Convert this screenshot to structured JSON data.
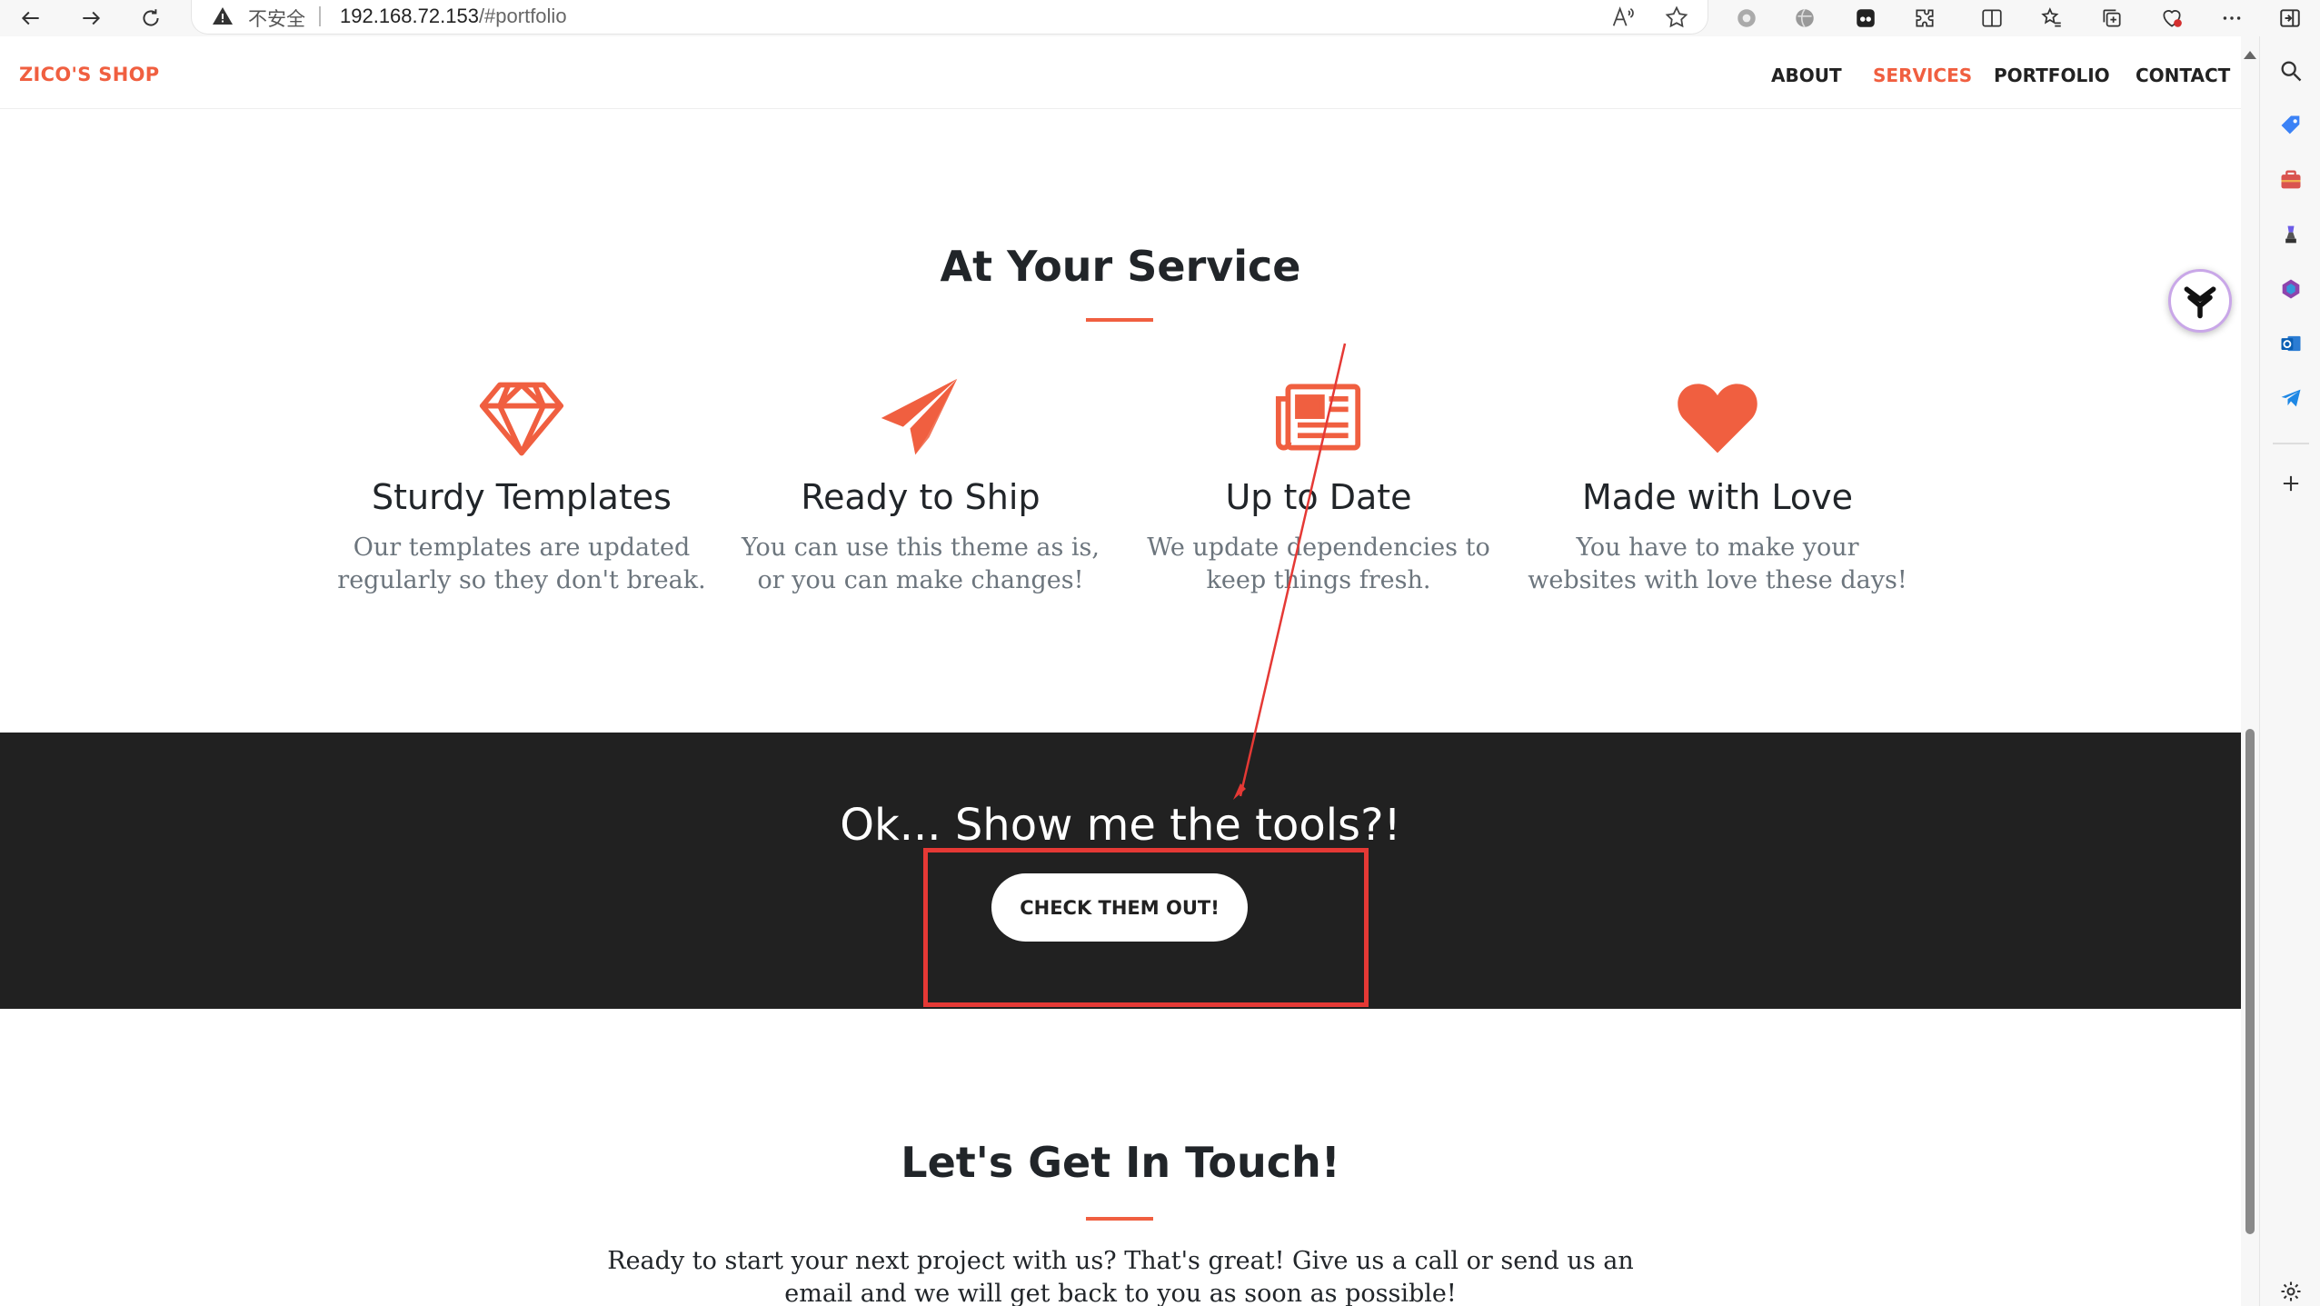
{
  "browser": {
    "insecure_label": "不安全",
    "url_host": "192.168.72.153",
    "url_path": "/#portfolio"
  },
  "nav": {
    "brand": "ZICO'S SHOP",
    "links": [
      {
        "label": "ABOUT",
        "active": false
      },
      {
        "label": "SERVICES",
        "active": true
      },
      {
        "label": "PORTFOLIO",
        "active": false
      },
      {
        "label": "CONTACT",
        "active": false
      }
    ]
  },
  "services": {
    "title": "At Your Service",
    "items": [
      {
        "icon": "diamond-icon",
        "title": "Sturdy Templates",
        "text": "Our templates are updated regularly so they don't break."
      },
      {
        "icon": "paper-plane-icon",
        "title": "Ready to Ship",
        "text": "You can use this theme as is, or you can make changes!"
      },
      {
        "icon": "newspaper-icon",
        "title": "Up to Date",
        "text": "We update dependencies to keep things fresh."
      },
      {
        "icon": "heart-icon",
        "title": "Made with Love",
        "text": "You have to make your websites with love these days!"
      }
    ]
  },
  "tools": {
    "title": "Ok... Show me the tools?!",
    "button": "CHECK THEM OUT!"
  },
  "contact": {
    "title": "Let's Get In Touch!",
    "text": "Ready to start your next project with us? That's great! Give us a call or send us an email and we will get back to you as soon as possible!"
  },
  "colors": {
    "accent": "#f05f40",
    "dark": "#212121",
    "annotation": "#e53935"
  }
}
